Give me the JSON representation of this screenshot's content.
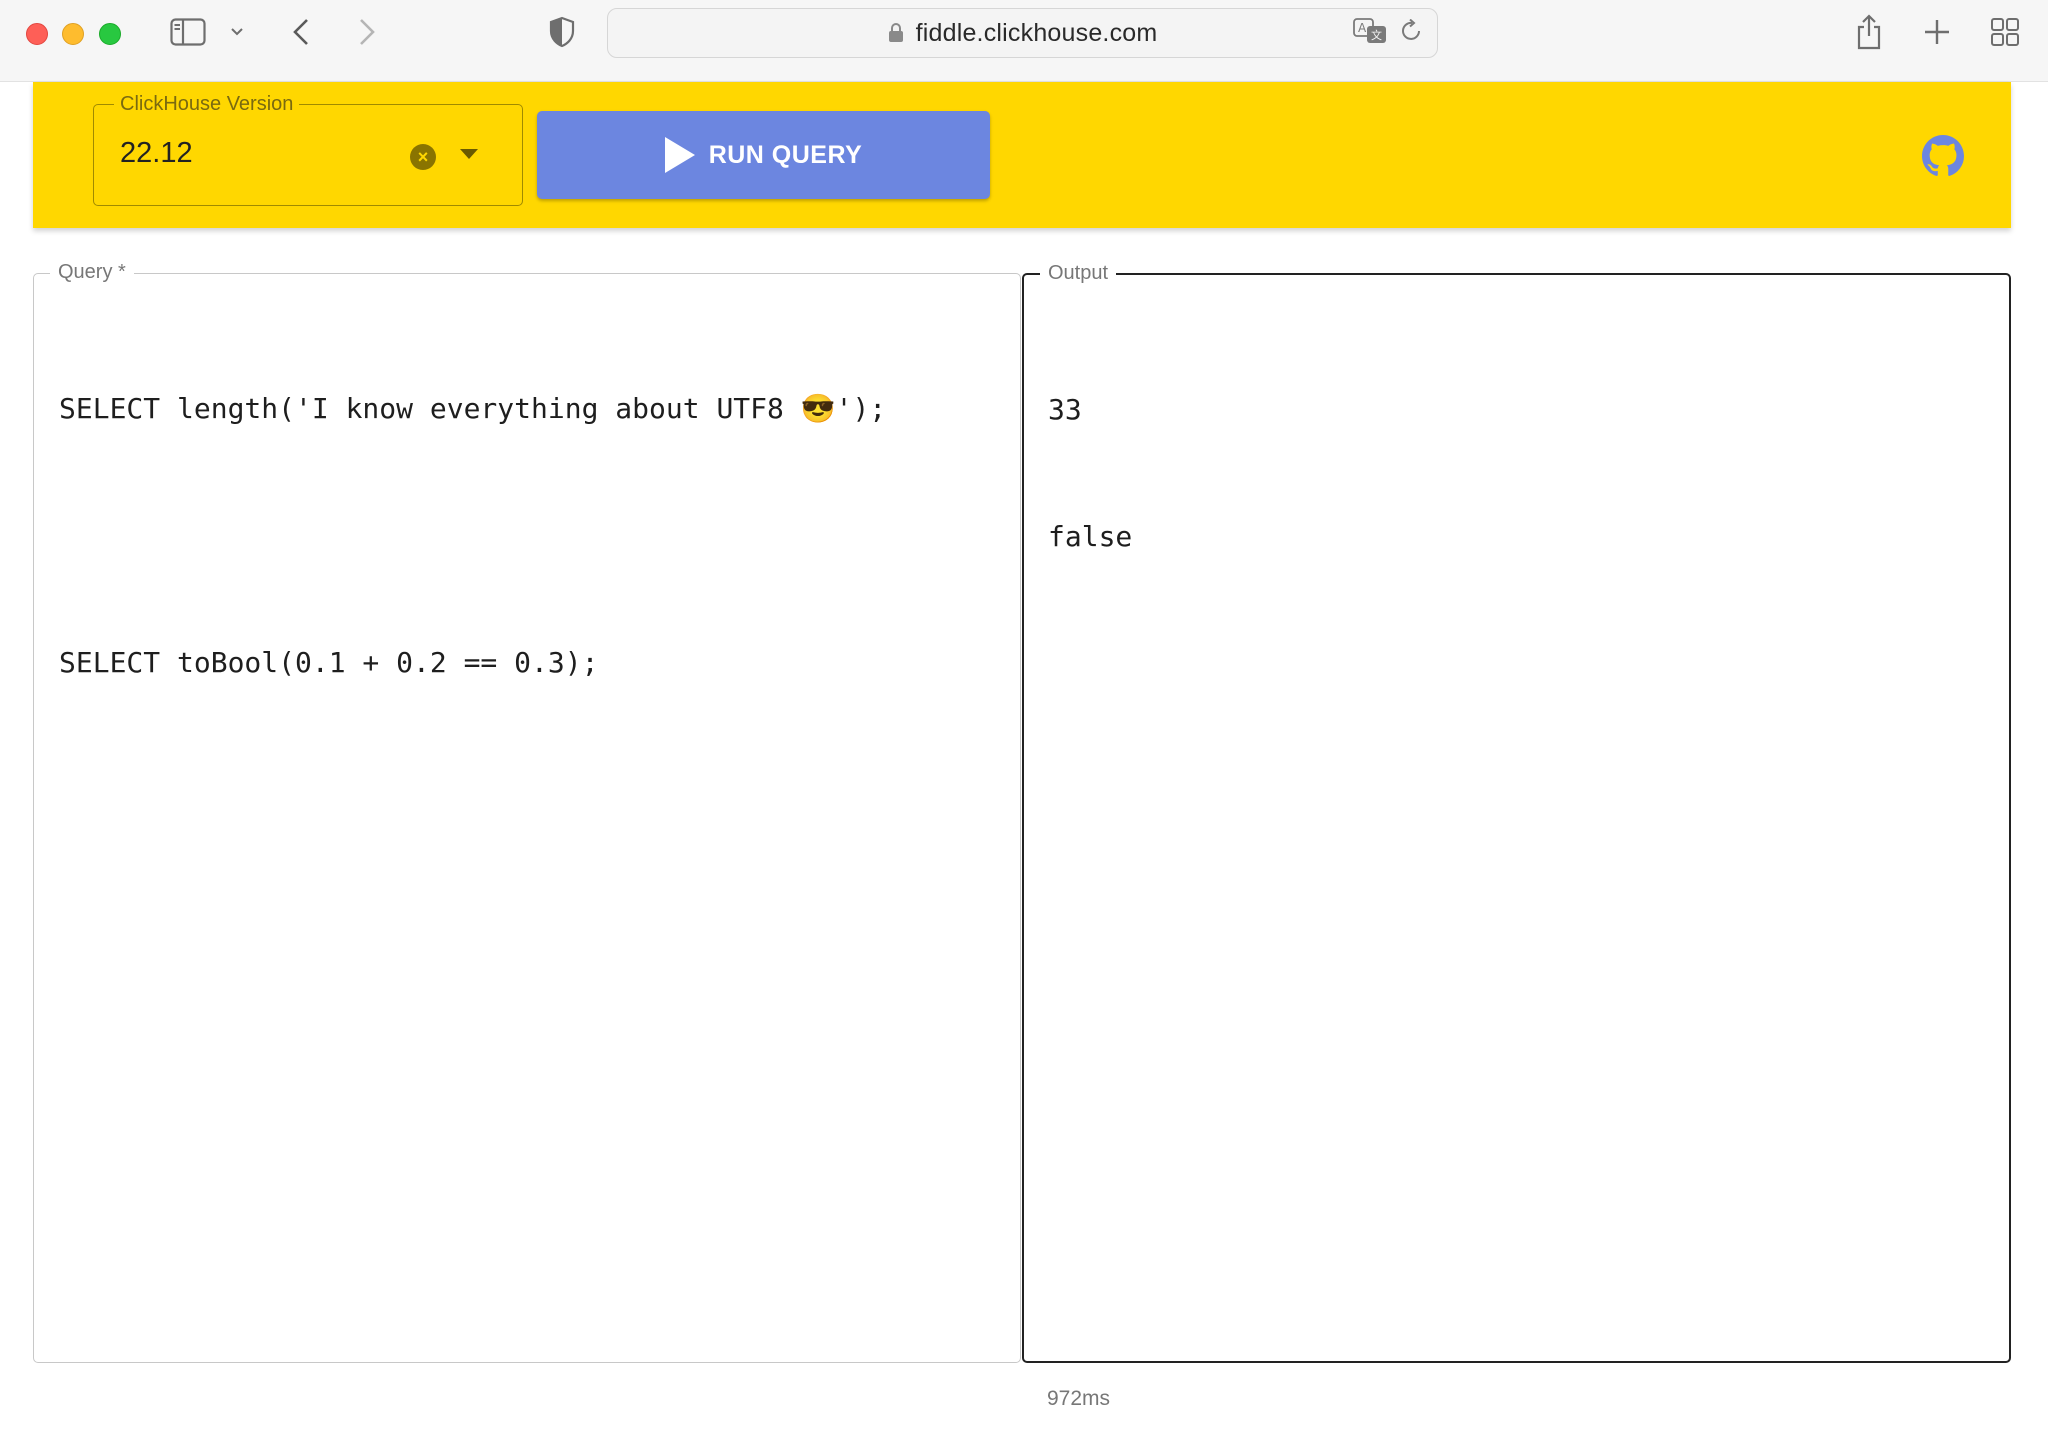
{
  "browser": {
    "url": "fiddle.clickhouse.com"
  },
  "header": {
    "version_label": "ClickHouse Version",
    "version_value": "22.12",
    "run_button_label": "RUN QUERY"
  },
  "query_panel": {
    "label": "Query *",
    "lines": [
      "SELECT length('I know everything about UTF8 😎');",
      "",
      "SELECT toBool(0.1 + 0.2 == 0.3);"
    ]
  },
  "output_panel": {
    "label": "Output",
    "lines": [
      "33",
      "false"
    ]
  },
  "footer": {
    "timing": "972ms"
  },
  "colors": {
    "header_bg": "#ffd700",
    "run_button_bg": "#6c86e0",
    "github_icon": "#6c86e0"
  },
  "icons": {
    "sidebar": "sidebar-icon",
    "back": "chevron-left-icon",
    "forward": "chevron-right-icon",
    "shield": "shield-icon",
    "lock": "lock-icon",
    "translate": "translate-icon",
    "reload": "reload-icon",
    "share": "share-icon",
    "new_tab": "plus-icon",
    "tab_overview": "grid-icon",
    "clear": "clear-icon",
    "dropdown": "dropdown-arrow-icon",
    "play": "play-icon",
    "github": "github-icon"
  }
}
